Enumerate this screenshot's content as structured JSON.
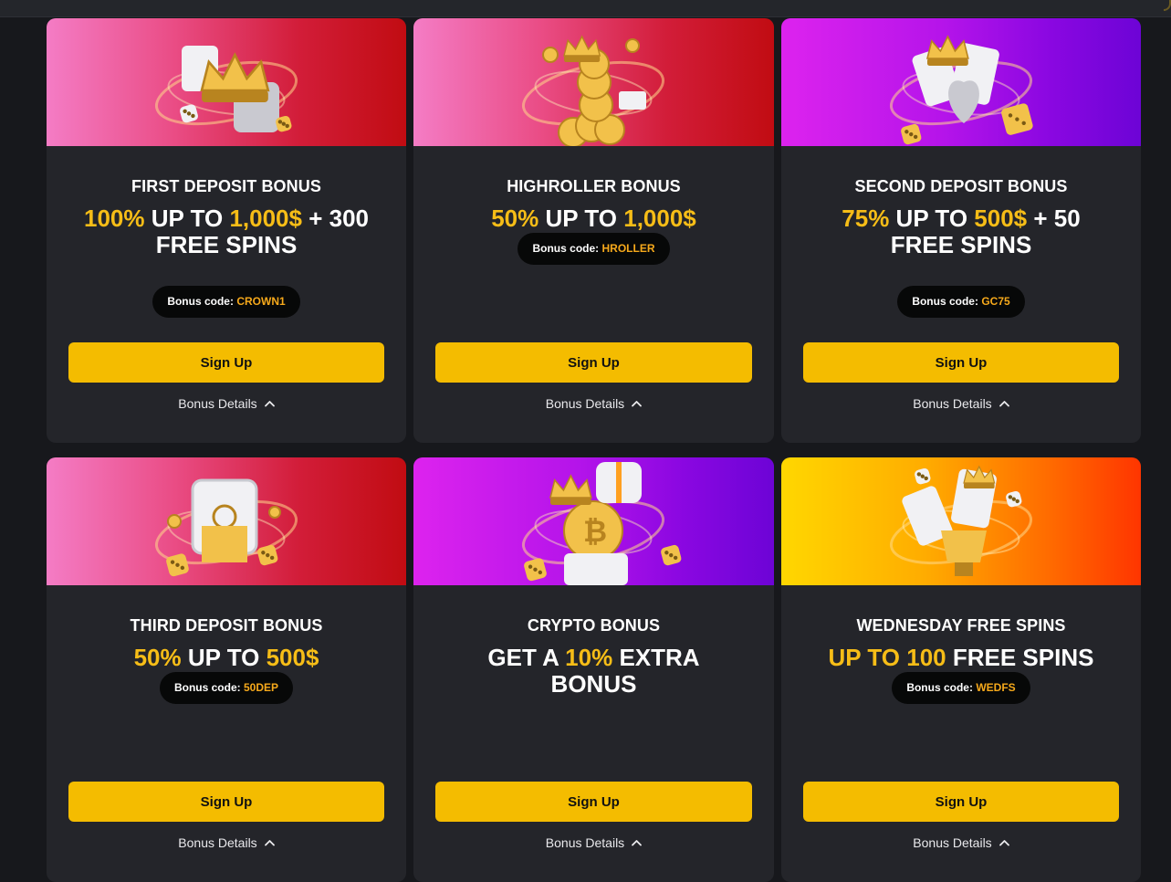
{
  "cards": [
    {
      "title": "FIRST DEPOSIT BONUS",
      "headline_parts": [
        {
          "text": "100%",
          "hl": true
        },
        {
          "text": " UP TO ",
          "hl": false
        },
        {
          "text": "1,000$",
          "hl": true
        },
        {
          "text": " + 300 FREE SPINS",
          "hl": false
        }
      ],
      "code_label": "Bonus code: ",
      "code": "CROWN1",
      "signup_label": "Sign Up",
      "details_label": "Bonus Details",
      "theme": "red",
      "art": "crown-gifts"
    },
    {
      "title": "HIGHROLLER BONUS",
      "headline_parts": [
        {
          "text": "50%",
          "hl": true
        },
        {
          "text": " UP TO ",
          "hl": false
        },
        {
          "text": "1,000$",
          "hl": true
        }
      ],
      "code_label": "Bonus code: ",
      "code": "HROLLER",
      "signup_label": "Sign Up",
      "details_label": "Bonus Details",
      "theme": "red",
      "art": "coin-stack"
    },
    {
      "title": "SECOND DEPOSIT BONUS",
      "headline_parts": [
        {
          "text": "75%",
          "hl": true
        },
        {
          "text": " UP TO ",
          "hl": false
        },
        {
          "text": "500$",
          "hl": true
        },
        {
          "text": " + 50 FREE SPINS",
          "hl": false
        }
      ],
      "code_label": "Bonus code: ",
      "code": "GC75",
      "signup_label": "Sign Up",
      "details_label": "Bonus Details",
      "theme": "purple",
      "art": "cards-dice"
    },
    {
      "title": "THIRD DEPOSIT BONUS",
      "headline_parts": [
        {
          "text": "50%",
          "hl": true
        },
        {
          "text": " UP TO ",
          "hl": false
        },
        {
          "text": "500$",
          "hl": true
        }
      ],
      "code_label": "Bonus code: ",
      "code": "50DEP",
      "signup_label": "Sign Up",
      "details_label": "Bonus Details",
      "theme": "red",
      "art": "safe-gold"
    },
    {
      "title": "CRYPTO BONUS",
      "headline_parts": [
        {
          "text": "GET A ",
          "hl": false
        },
        {
          "text": "10%",
          "hl": true
        },
        {
          "text": " EXTRA BONUS",
          "hl": false
        }
      ],
      "code_label": "",
      "code": "",
      "signup_label": "Sign Up",
      "details_label": "Bonus Details",
      "theme": "purple",
      "art": "bitcoin-gift"
    },
    {
      "title": "WEDNESDAY FREE SPINS",
      "headline_parts": [
        {
          "text": "UP TO 100",
          "hl": true
        },
        {
          "text": " FREE SPINS",
          "hl": false
        }
      ],
      "code_label": "Bonus code: ",
      "code": "WEDFS",
      "signup_label": "Sign Up",
      "details_label": "Bonus Details",
      "theme": "orange",
      "art": "trophy-cards"
    }
  ],
  "colors": {
    "highlight": "#f6bd17",
    "code": "#f6a91b",
    "button": "#f4bc00",
    "card": "#24252a",
    "page": "#17181c"
  }
}
